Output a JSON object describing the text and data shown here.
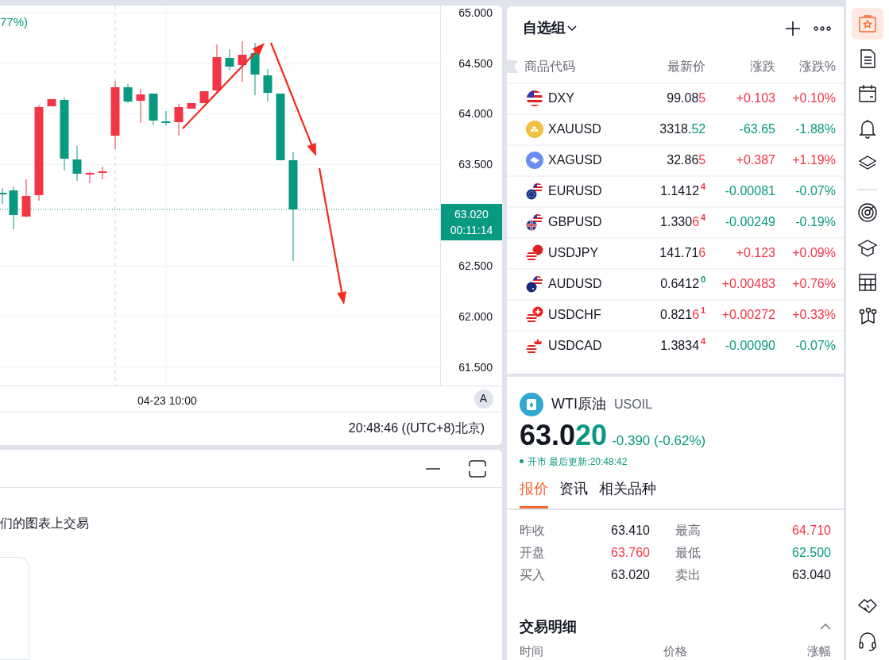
{
  "chart": {
    "change_fragment": "77%)",
    "y_labels": [
      "65.000",
      "64.500",
      "64.000",
      "63.500",
      "62.500",
      "62.000",
      "61.500"
    ],
    "x_label": "04-23 10:00",
    "price_tag": "63.020",
    "countdown": "00:11:14",
    "scale_button": "A"
  },
  "status_bar": {
    "time": "20:48:46 ((UTC+8)北京)"
  },
  "bottom_panel": {
    "text": "们的图表上交易"
  },
  "watchlist": {
    "title": "自选组",
    "columns": [
      "商品代码",
      "最新价",
      "涨跌",
      "涨跌%"
    ],
    "rows": [
      {
        "kind": "us",
        "symbol": "DXY",
        "price": "99.08",
        "price_hl": {
          "text": "5",
          "color": "#f23645"
        },
        "change": "+0.103",
        "change_pct": "+0.10%",
        "color": "#f23645"
      },
      {
        "kind": "gold",
        "symbol": "XAUUSD",
        "price": "3318.",
        "price_hl": {
          "text": "52",
          "color": "#089981"
        },
        "change": "-63.65",
        "change_pct": "-1.88%",
        "color": "#089981"
      },
      {
        "kind": "silver",
        "symbol": "XAGUSD",
        "price": "32.86",
        "price_hl": {
          "text": "5",
          "color": "#f23645"
        },
        "change": "+0.387",
        "change_pct": "+1.19%",
        "color": "#f23645"
      },
      {
        "kind": "eu",
        "symbol": "EURUSD",
        "price": "1.1412",
        "price_sup": {
          "text": "4",
          "color": "#f23645"
        },
        "change": "-0.00081",
        "change_pct": "-0.07%",
        "color": "#089981"
      },
      {
        "kind": "gb",
        "symbol": "GBPUSD",
        "price": "1.330",
        "price_hl": {
          "text": "6",
          "color": "#f23645"
        },
        "price_sup": {
          "text": "4",
          "color": "#f23645"
        },
        "change": "-0.00249",
        "change_pct": "-0.19%",
        "color": "#089981"
      },
      {
        "kind": "jp",
        "symbol": "USDJPY",
        "price": "141.71",
        "price_hl": {
          "text": "6",
          "color": "#f23645"
        },
        "change": "+0.123",
        "change_pct": "+0.09%",
        "color": "#f23645"
      },
      {
        "kind": "au",
        "symbol": "AUDUSD",
        "price": "0.6412",
        "price_sup": {
          "text": "0",
          "color": "#089981"
        },
        "change": "+0.00483",
        "change_pct": "+0.76%",
        "color": "#f23645"
      },
      {
        "kind": "ch",
        "symbol": "USDCHF",
        "price": "0.821",
        "price_hl": {
          "text": "6",
          "color": "#f23645"
        },
        "price_sup": {
          "text": "1",
          "color": "#f23645"
        },
        "change": "+0.00272",
        "change_pct": "+0.33%",
        "color": "#f23645"
      },
      {
        "kind": "ca",
        "symbol": "USDCAD",
        "price": "1.3834",
        "price_sup": {
          "text": "4",
          "color": "#f23645"
        },
        "change": "-0.00090",
        "change_pct": "-0.07%",
        "color": "#089981"
      }
    ]
  },
  "quote": {
    "name": "WTI原油",
    "symbol": "USOIL",
    "price": "63.0",
    "price_hl": "20",
    "color": "#089981",
    "change": "-0.390 (-0.62%)",
    "status": "开市 最后更新:20:48:42",
    "tabs": [
      {
        "label": "报价",
        "selected": true
      },
      {
        "label": "资讯",
        "selected": false
      },
      {
        "label": "相关品种",
        "selected": false
      }
    ],
    "stats": [
      {
        "label": "昨收",
        "value": "63.410",
        "color": "#131722"
      },
      {
        "label": "最高",
        "value": "64.710",
        "color": "#f23645"
      },
      {
        "label": "开盘",
        "value": "63.760",
        "color": "#f23645"
      },
      {
        "label": "最低",
        "value": "62.500",
        "color": "#089981"
      },
      {
        "label": "买入",
        "value": "63.020",
        "color": "#131722"
      },
      {
        "label": "卖出",
        "value": "63.040",
        "color": "#131722"
      }
    ],
    "trades": {
      "title": "交易明细",
      "columns": [
        "时间",
        "价格",
        "涨幅"
      ]
    }
  },
  "sidebar": {
    "top_items": [
      {
        "kind": "watchlist",
        "selected": true
      },
      {
        "kind": "document",
        "selected": false
      },
      {
        "kind": "calendar",
        "selected": false
      },
      {
        "kind": "bell",
        "selected": false
      },
      {
        "kind": "layers",
        "selected": false
      }
    ],
    "middle_items": [
      {
        "kind": "target",
        "selected": false
      },
      {
        "kind": "graduation",
        "selected": false
      },
      {
        "kind": "table",
        "selected": false
      },
      {
        "kind": "network",
        "selected": false
      }
    ],
    "bottom_items": [
      {
        "kind": "handshake",
        "selected": false
      },
      {
        "kind": "headset",
        "selected": false
      }
    ]
  }
}
